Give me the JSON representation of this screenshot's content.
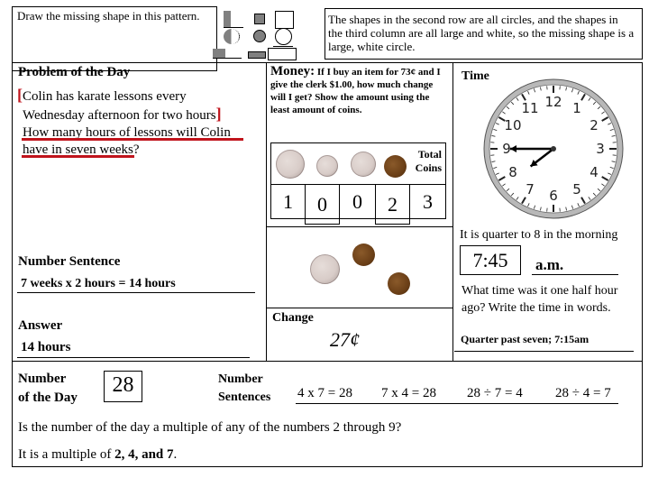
{
  "pattern": {
    "prompt": "Draw the missing shape in this pattern.",
    "explanation": "The shapes in the second row are all circles, and the shapes in the third column are all large and white, so the missing shape is a large, white circle."
  },
  "problem_of_the_day": {
    "title": "Problem of the Day",
    "bracket_open": "[",
    "bracket_close": "]",
    "line1": "Colin has karate lessons every",
    "line2": "Wednesday afternoon for two hours",
    "line3": "How many hours of lessons will Colin",
    "line4": "have in seven weeks?",
    "number_sentence_label": "Number Sentence",
    "number_sentence": "7 weeks x 2 hours = 14 hours",
    "answer_label": "Answer",
    "answer": "14 hours"
  },
  "money": {
    "label": "Money:",
    "question": "If I buy an item for 73¢ and I give the clerk $1.00, how much change will I get?  Show the amount using the least amount of coins.",
    "coins": [
      "quarter",
      "dime",
      "nickel",
      "penny"
    ],
    "total_label_1": "Total",
    "total_label_2": "Coins",
    "counts": [
      "1",
      "0",
      "0",
      "2",
      "3"
    ],
    "change_label": "Change",
    "change_value": "27¢"
  },
  "time": {
    "title": "Time",
    "clock_hours": 7,
    "clock_minutes": 45,
    "clock_numbers": [
      "12",
      "1",
      "2",
      "3",
      "4",
      "5",
      "6",
      "7",
      "8",
      "9",
      "10",
      "11"
    ],
    "statement": "It is quarter to 8 in the morning",
    "digital": "7:45",
    "meridiem": "a.m.",
    "question": "What time was it one half hour ago? Write the time in words.",
    "answer": "Quarter past seven;  7:15am"
  },
  "number_of_the_day": {
    "label_1": "Number",
    "label_2": "of the Day",
    "value": "28",
    "sentences_label_1": "Number",
    "sentences_label_2": "Sentences",
    "sentences": [
      "4 x 7 = 28",
      "7 x 4 = 28",
      "28 ÷ 7 = 4",
      "28 ÷ 4 = 7"
    ],
    "question": "Is the number of the day a multiple of any of the numbers 2 through 9?",
    "answer_prefix": "It is a multiple of ",
    "answer_values": "2, 4, and 7",
    "answer_suffix": "."
  }
}
